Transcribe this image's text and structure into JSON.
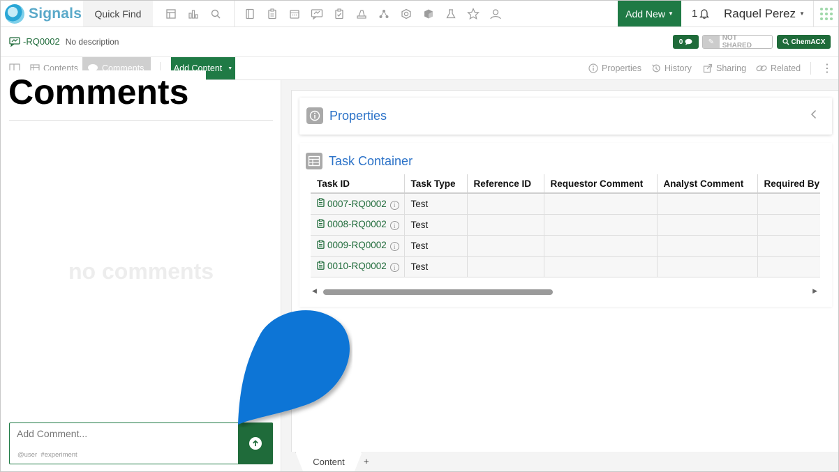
{
  "app": {
    "name": "Signals",
    "quick_find": "Quick Find",
    "add_new": "Add New",
    "notification_count": "1",
    "user_name": "Raquel Perez"
  },
  "entity": {
    "id": "-RQ0002",
    "description": "No description",
    "comment_count": "0",
    "share_status": "NOT SHARED",
    "chem_button": "ChemACX"
  },
  "toolbar": {
    "contents": "Contents",
    "comments": "Comments",
    "add_content": "Add Content",
    "properties": "Properties",
    "history": "History",
    "sharing": "Sharing",
    "related": "Related"
  },
  "comments_panel": {
    "heading": "Comments",
    "empty_text": "no comments",
    "input_placeholder": "Add Comment...",
    "hint_user": "@user",
    "hint_tag": "#experiment"
  },
  "properties_card": {
    "title": "Properties"
  },
  "task_container": {
    "title": "Task Container",
    "columns": [
      "Task ID",
      "Task Type",
      "Reference ID",
      "Requestor Comment",
      "Analyst Comment",
      "Required By"
    ],
    "rows": [
      {
        "task_id": "0007-RQ0002",
        "task_type": "Test",
        "reference_id": "",
        "requestor_comment": "",
        "analyst_comment": "",
        "required_by": ""
      },
      {
        "task_id": "0008-RQ0002",
        "task_type": "Test",
        "reference_id": "",
        "requestor_comment": "",
        "analyst_comment": "",
        "required_by": ""
      },
      {
        "task_id": "0009-RQ0002",
        "task_type": "Test",
        "reference_id": "",
        "requestor_comment": "",
        "analyst_comment": "",
        "required_by": ""
      },
      {
        "task_id": "0010-RQ0002",
        "task_type": "Test",
        "reference_id": "",
        "requestor_comment": "",
        "analyst_comment": "",
        "required_by": ""
      }
    ]
  },
  "bottom_tabs": {
    "content": "Content",
    "add": "+"
  },
  "colors": {
    "brand_green": "#1f7a45",
    "link_blue": "#2b72c8",
    "callout_blue": "#0a74d6"
  },
  "icons": [
    "signals-logo-icon",
    "notebook-icon",
    "chart-icon",
    "search-icon",
    "journal-icon",
    "clipboard-icon",
    "calendar-icon",
    "request-icon",
    "task-icon",
    "lab-icon",
    "network-icon",
    "hexagon-icon",
    "cube-icon",
    "flask-icon",
    "star-icon",
    "user-icon",
    "bell-icon",
    "apps-grid-icon",
    "comment-icon",
    "pencil-icon",
    "send-arrow-icon",
    "info-icon",
    "table-icon",
    "chevron-left-icon"
  ]
}
